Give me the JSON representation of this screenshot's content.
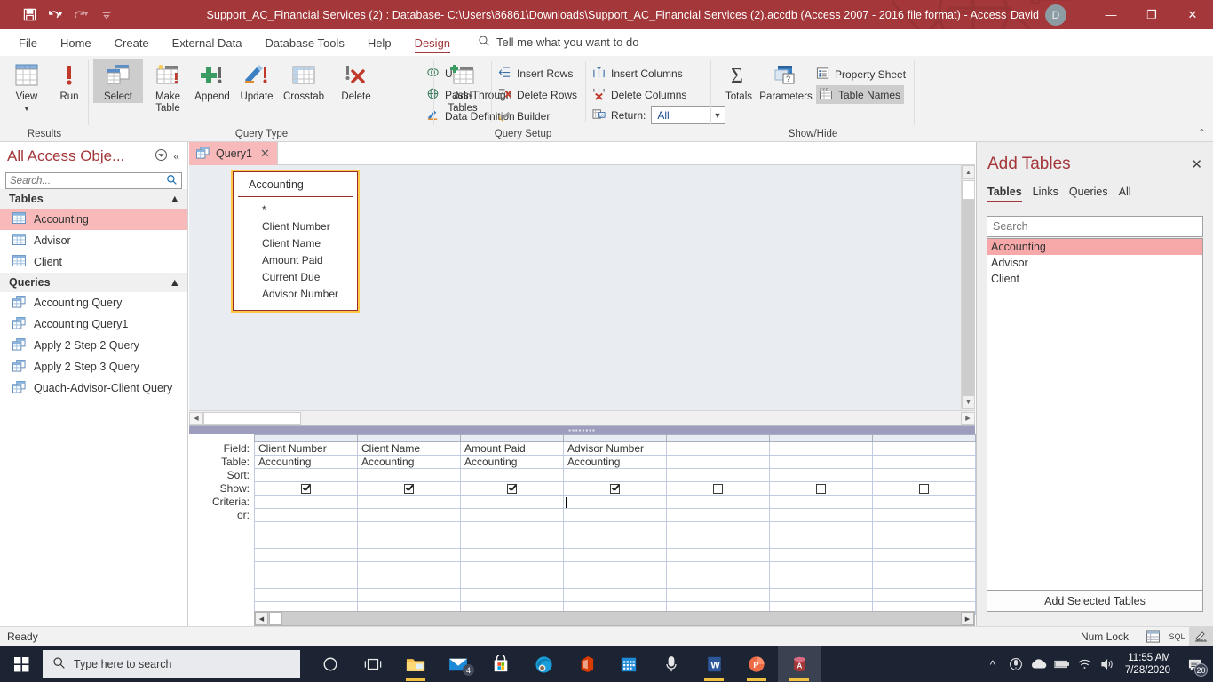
{
  "titlebar": {
    "title": "Support_AC_Financial Services (2) : Database- C:\\Users\\86861\\Downloads\\Support_AC_Financial Services (2).accdb (Access 2007 - 2016 file format)  -  Access",
    "user_name": "David",
    "user_initial": "D",
    "qat": [
      {
        "name": "save-icon",
        "label": "Save"
      },
      {
        "name": "undo-icon",
        "label": "Undo"
      },
      {
        "name": "redo-icon",
        "label": "Redo"
      },
      {
        "name": "customize-qat-icon",
        "label": "Customize Quick Access Toolbar"
      }
    ],
    "window_buttons": {
      "minimize": "—",
      "restore": "❐",
      "close": "✕"
    }
  },
  "ribbon": {
    "tabs": [
      {
        "label": "File",
        "active": false
      },
      {
        "label": "Home",
        "active": false
      },
      {
        "label": "Create",
        "active": false
      },
      {
        "label": "External Data",
        "active": false
      },
      {
        "label": "Database Tools",
        "active": false
      },
      {
        "label": "Help",
        "active": false
      },
      {
        "label": "Design",
        "active": true
      }
    ],
    "tellme": "Tell me what you want to do",
    "collapse": "⌃",
    "groups": {
      "results": {
        "title": "Results",
        "view": "View",
        "run": "Run"
      },
      "query_type": {
        "title": "Query Type",
        "select": "Select",
        "make_table": "Make Table",
        "append": "Append",
        "update": "Update",
        "crosstab": "Crosstab",
        "delete": "Delete",
        "union": "Union",
        "pass_through": "Pass-Through",
        "data_definition": "Data Definition"
      },
      "query_setup": {
        "title": "Query Setup",
        "add_tables": "Add Tables",
        "insert_rows": "Insert Rows",
        "delete_rows": "Delete Rows",
        "builder": "Builder",
        "insert_columns": "Insert Columns",
        "delete_columns": "Delete Columns",
        "return_label": "Return:",
        "return_value": "All"
      },
      "show_hide": {
        "title": "Show/Hide",
        "totals": "Totals",
        "parameters": "Parameters",
        "property_sheet": "Property Sheet",
        "table_names": "Table Names"
      }
    }
  },
  "navpane": {
    "title": "All Access Obje...",
    "search_placeholder": "Search...",
    "groups": [
      {
        "label": "Tables",
        "items": [
          {
            "label": "Accounting",
            "selected": true
          },
          {
            "label": "Advisor",
            "selected": false
          },
          {
            "label": "Client",
            "selected": false
          }
        ]
      },
      {
        "label": "Queries",
        "items": [
          {
            "label": "Accounting Query",
            "selected": false
          },
          {
            "label": "Accounting Query1",
            "selected": false
          },
          {
            "label": "Apply 2 Step 2 Query",
            "selected": false
          },
          {
            "label": "Apply 2 Step 3 Query",
            "selected": false
          },
          {
            "label": "Quach-Advisor-Client Query",
            "selected": false
          }
        ]
      }
    ]
  },
  "document": {
    "tab_label": "Query1",
    "table_box": {
      "title": "Accounting",
      "fields": [
        "*",
        "Client Number",
        "Client Name",
        "Amount Paid",
        "Current Due",
        "Advisor Number"
      ]
    }
  },
  "query_grid": {
    "row_labels": [
      "Field:",
      "Table:",
      "Sort:",
      "Show:",
      "Criteria:",
      "or:"
    ],
    "columns": [
      {
        "field": "Client Number",
        "table": "Accounting",
        "sort": "",
        "show": true,
        "criteria": "",
        "or": ""
      },
      {
        "field": "Client Name",
        "table": "Accounting",
        "sort": "",
        "show": true,
        "criteria": "",
        "or": ""
      },
      {
        "field": "Amount Paid",
        "table": "Accounting",
        "sort": "",
        "show": true,
        "criteria": "",
        "or": ""
      },
      {
        "field": "Advisor Number",
        "table": "Accounting",
        "sort": "",
        "show": true,
        "criteria": "",
        "or": "",
        "cursor": true
      },
      {
        "field": "",
        "table": "",
        "sort": "",
        "show": false,
        "criteria": "",
        "or": ""
      },
      {
        "field": "",
        "table": "",
        "sort": "",
        "show": false,
        "criteria": "",
        "or": ""
      },
      {
        "field": "",
        "table": "",
        "sort": "",
        "show": false,
        "criteria": "",
        "or": ""
      }
    ],
    "empty_rows": 7
  },
  "add_tables": {
    "title": "Add Tables",
    "close": "✕",
    "tabs": [
      {
        "label": "Tables",
        "active": true
      },
      {
        "label": "Links",
        "active": false
      },
      {
        "label": "Queries",
        "active": false
      },
      {
        "label": "All",
        "active": false
      }
    ],
    "search_placeholder": "Search",
    "items": [
      {
        "label": "Accounting",
        "selected": true
      },
      {
        "label": "Advisor",
        "selected": false
      },
      {
        "label": "Client",
        "selected": false
      }
    ],
    "add_button": "Add Selected Tables"
  },
  "statusbar": {
    "message": "Ready",
    "num_lock": "Num Lock",
    "views": [
      {
        "name": "datasheet-view-icon",
        "selected": false
      },
      {
        "name": "sql-view-icon",
        "label": "SQL",
        "selected": false
      },
      {
        "name": "design-view-icon",
        "selected": true
      }
    ]
  },
  "taskbar": {
    "search_placeholder": "Type here to search",
    "apps": [
      {
        "name": "cortana-icon",
        "label": "Cortana"
      },
      {
        "name": "task-view-icon",
        "label": "Task View"
      },
      {
        "name": "file-explorer-icon",
        "label": "File Explorer"
      },
      {
        "name": "mail-icon",
        "label": "Mail",
        "badge": "4"
      },
      {
        "name": "microsoft-store-icon",
        "label": "Microsoft Store"
      },
      {
        "name": "edge-icon",
        "label": "Microsoft Edge"
      },
      {
        "name": "office-icon",
        "label": "Office"
      },
      {
        "name": "calendar-icon",
        "label": "Calendar"
      },
      {
        "name": "voice-recorder-icon",
        "label": "Voice Recorder"
      },
      {
        "name": "word-icon",
        "label": "Word"
      },
      {
        "name": "powerpoint-icon",
        "label": "PowerPoint"
      },
      {
        "name": "access-icon",
        "label": "Access"
      }
    ],
    "tray": {
      "time": "11:55 AM",
      "date": "7/28/2020",
      "notification_count": "20"
    }
  },
  "colors": {
    "accent": "#a4373a",
    "title_bar": "#a4373a",
    "selection": "#f7b9b9",
    "taskbar": "#1c2433"
  }
}
